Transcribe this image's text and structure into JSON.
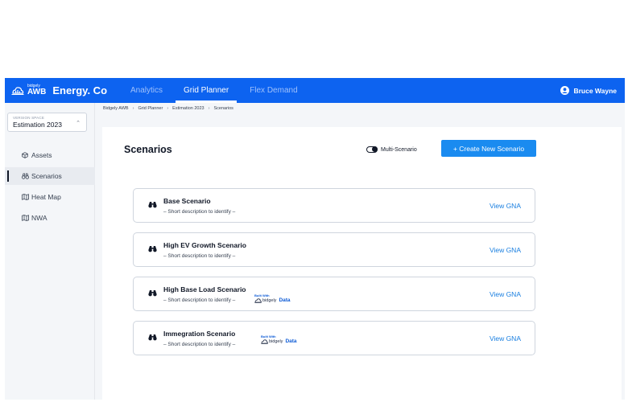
{
  "header": {
    "logo_small": "bidgely",
    "logo_product": "AWB",
    "brand_name": "Energy. Co",
    "tabs": [
      {
        "label": "Analytics",
        "active": false
      },
      {
        "label": "Grid Planner",
        "active": true
      },
      {
        "label": "Flex Demand",
        "active": false
      }
    ],
    "user_name": "Bruce Wayne"
  },
  "sidebar": {
    "version_label": "VERSION SPACE",
    "version_value": "Estimation 2023",
    "items": [
      {
        "label": "Assets",
        "icon": "cube-icon",
        "active": false
      },
      {
        "label": "Scenarios",
        "icon": "binoculars-icon",
        "active": true
      },
      {
        "label": "Heat Map",
        "icon": "map-icon",
        "active": false
      },
      {
        "label": "NWA",
        "icon": "map-icon",
        "active": false
      }
    ]
  },
  "breadcrumb": [
    "Bidgely AWB",
    "Grid Planner",
    "Estimation 2023",
    "Scenarios"
  ],
  "main": {
    "title": "Scenarios",
    "toggle_label": "Multi-Scenario",
    "create_button": "+ Create New Scenario",
    "scenarios": [
      {
        "name": "Base Scenario",
        "description": "– Short description to identify –",
        "action": "View GNA",
        "built_with": false
      },
      {
        "name": "High EV Growth Scenario",
        "description": "– Short description to identify –",
        "action": "View GNA",
        "built_with": false
      },
      {
        "name": "High Base Load Scenario",
        "description": "– Short description to identify –",
        "action": "View GNA",
        "built_with": true
      },
      {
        "name": "Immegration Scenario",
        "description": "– Short description to identify –",
        "action": "View GNA",
        "built_with": true
      }
    ],
    "built_with": {
      "prefix": "Built With",
      "brand": "bidgely",
      "suffix": "Data"
    }
  },
  "colors": {
    "header_bg": "#0d63f0",
    "primary_button": "#1a8bf0",
    "link": "#1a7fe0",
    "badge_blue": "#0d5bd6"
  }
}
